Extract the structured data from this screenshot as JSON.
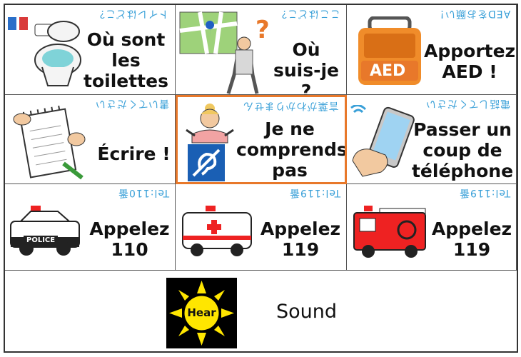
{
  "cards": [
    {
      "id": "toilet",
      "jp": "トイレはどこ？",
      "label_lines": [
        "Où sont",
        "les",
        "toilettes ?"
      ]
    },
    {
      "id": "where",
      "jp": "ここはどこ？",
      "label_lines": [
        "Où",
        "suis-je ?"
      ]
    },
    {
      "id": "aed",
      "jp": "AEDをお願い！",
      "label_lines": [
        "Apportez",
        "AED !"
      ],
      "aed_text": "AED"
    },
    {
      "id": "write",
      "jp": "書いてください",
      "label_lines": [
        "Écrire !"
      ]
    },
    {
      "id": "understand",
      "jp": "言葉がわかりません",
      "label_lines": [
        "Je ne",
        "comprends",
        "pas"
      ]
    },
    {
      "id": "phone",
      "jp": "電話してください",
      "label_lines": [
        "Passer un",
        "coup de",
        "téléphone !"
      ]
    },
    {
      "id": "police",
      "jp": "Tel:110番",
      "label_lines": [
        "Appelez",
        "110"
      ],
      "police_text": "POLICE"
    },
    {
      "id": "ambulance",
      "jp": "Tel:119番",
      "label_lines": [
        "Appelez",
        "119"
      ]
    },
    {
      "id": "fire",
      "jp": "Tel:119番",
      "label_lines": [
        "Appelez",
        "119"
      ]
    }
  ],
  "sound": {
    "hear_label": "Hear",
    "text": "Sound"
  },
  "colors": {
    "accent_border": "#e8782a",
    "jp_text": "#3aa0d8",
    "sun": "#ffe600"
  }
}
